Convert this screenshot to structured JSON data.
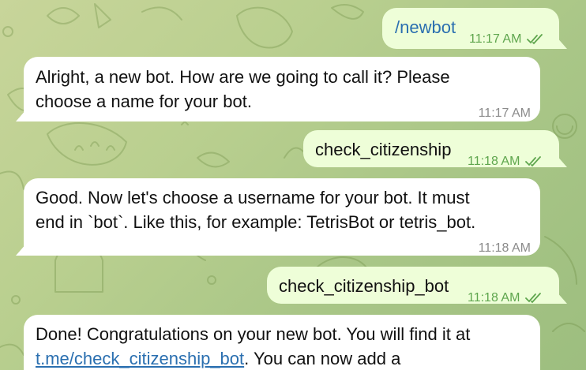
{
  "messages": [
    {
      "direction": "outgoing",
      "text": "/newbot",
      "is_command": true,
      "time": "11:17 AM",
      "status": "read"
    },
    {
      "direction": "incoming",
      "lines": [
        "Alright, a new bot. How are we going to call it? Please",
        "choose a name for your bot."
      ],
      "time": "11:17 AM"
    },
    {
      "direction": "outgoing",
      "text": "check_citizenship",
      "time": "11:18 AM",
      "status": "read"
    },
    {
      "direction": "incoming",
      "lines": [
        "Good. Now let's choose a username for your bot. It must",
        "end in `bot`. Like this, for example: TetrisBot or tetris_bot."
      ],
      "time": "11:18 AM"
    },
    {
      "direction": "outgoing",
      "text": "check_citizenship_bot",
      "time": "11:18 AM",
      "status": "read"
    },
    {
      "direction": "incoming",
      "line1": "Done! Congratulations on your new bot. You will find it at",
      "link": "t.me/check_citizenship_bot",
      "line2_rest": ". You can now add a"
    }
  ],
  "colors": {
    "background": "#b9cf8f",
    "incoming_bubble": "#ffffff",
    "outgoing_bubble": "#eefed8",
    "time_incoming": "#8b8b8b",
    "time_outgoing": "#5fa64e",
    "link": "#2a6fb0"
  },
  "icons": {
    "read_receipt": "double-check-icon"
  }
}
